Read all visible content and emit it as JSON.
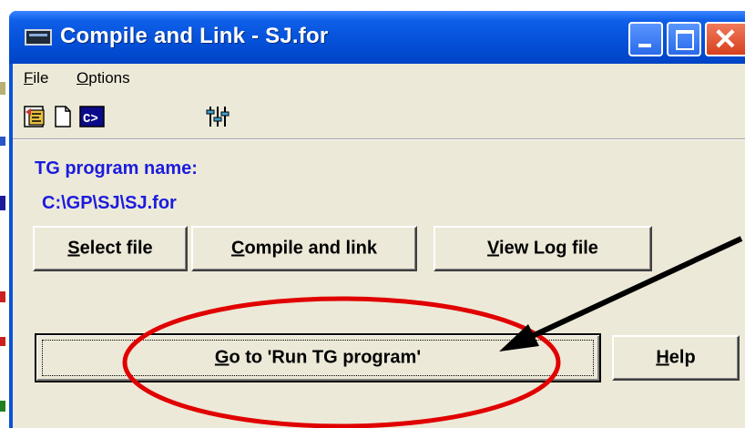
{
  "window": {
    "title": "Compile and Link - SJ.for",
    "icon": "app-window-icon",
    "controls": [
      "minimize",
      "maximize",
      "close"
    ]
  },
  "menu": {
    "file": {
      "accel": "F",
      "rest": "ile"
    },
    "options": {
      "accel": "O",
      "rest": "ptions"
    }
  },
  "toolbar": {
    "icons": [
      "compile-icon",
      "new-document-icon",
      "console-icon",
      "settings-sliders-icon"
    ]
  },
  "program": {
    "name_label": "TG program name:",
    "path": "C:\\GP\\SJ\\SJ.for"
  },
  "buttons": {
    "select_file": {
      "accel": "S",
      "rest": "elect file"
    },
    "compile_link": {
      "accel": "C",
      "rest": "ompile and link"
    },
    "view_log": {
      "accel": "V",
      "rest": "iew Log file"
    },
    "go_run": {
      "accel": "G",
      "rest": "o to 'Run TG program'"
    },
    "help": {
      "accel": "H",
      "rest": "elp"
    }
  },
  "annotation": {
    "ellipse_color": "#e00000",
    "arrow_color": "#000000"
  }
}
